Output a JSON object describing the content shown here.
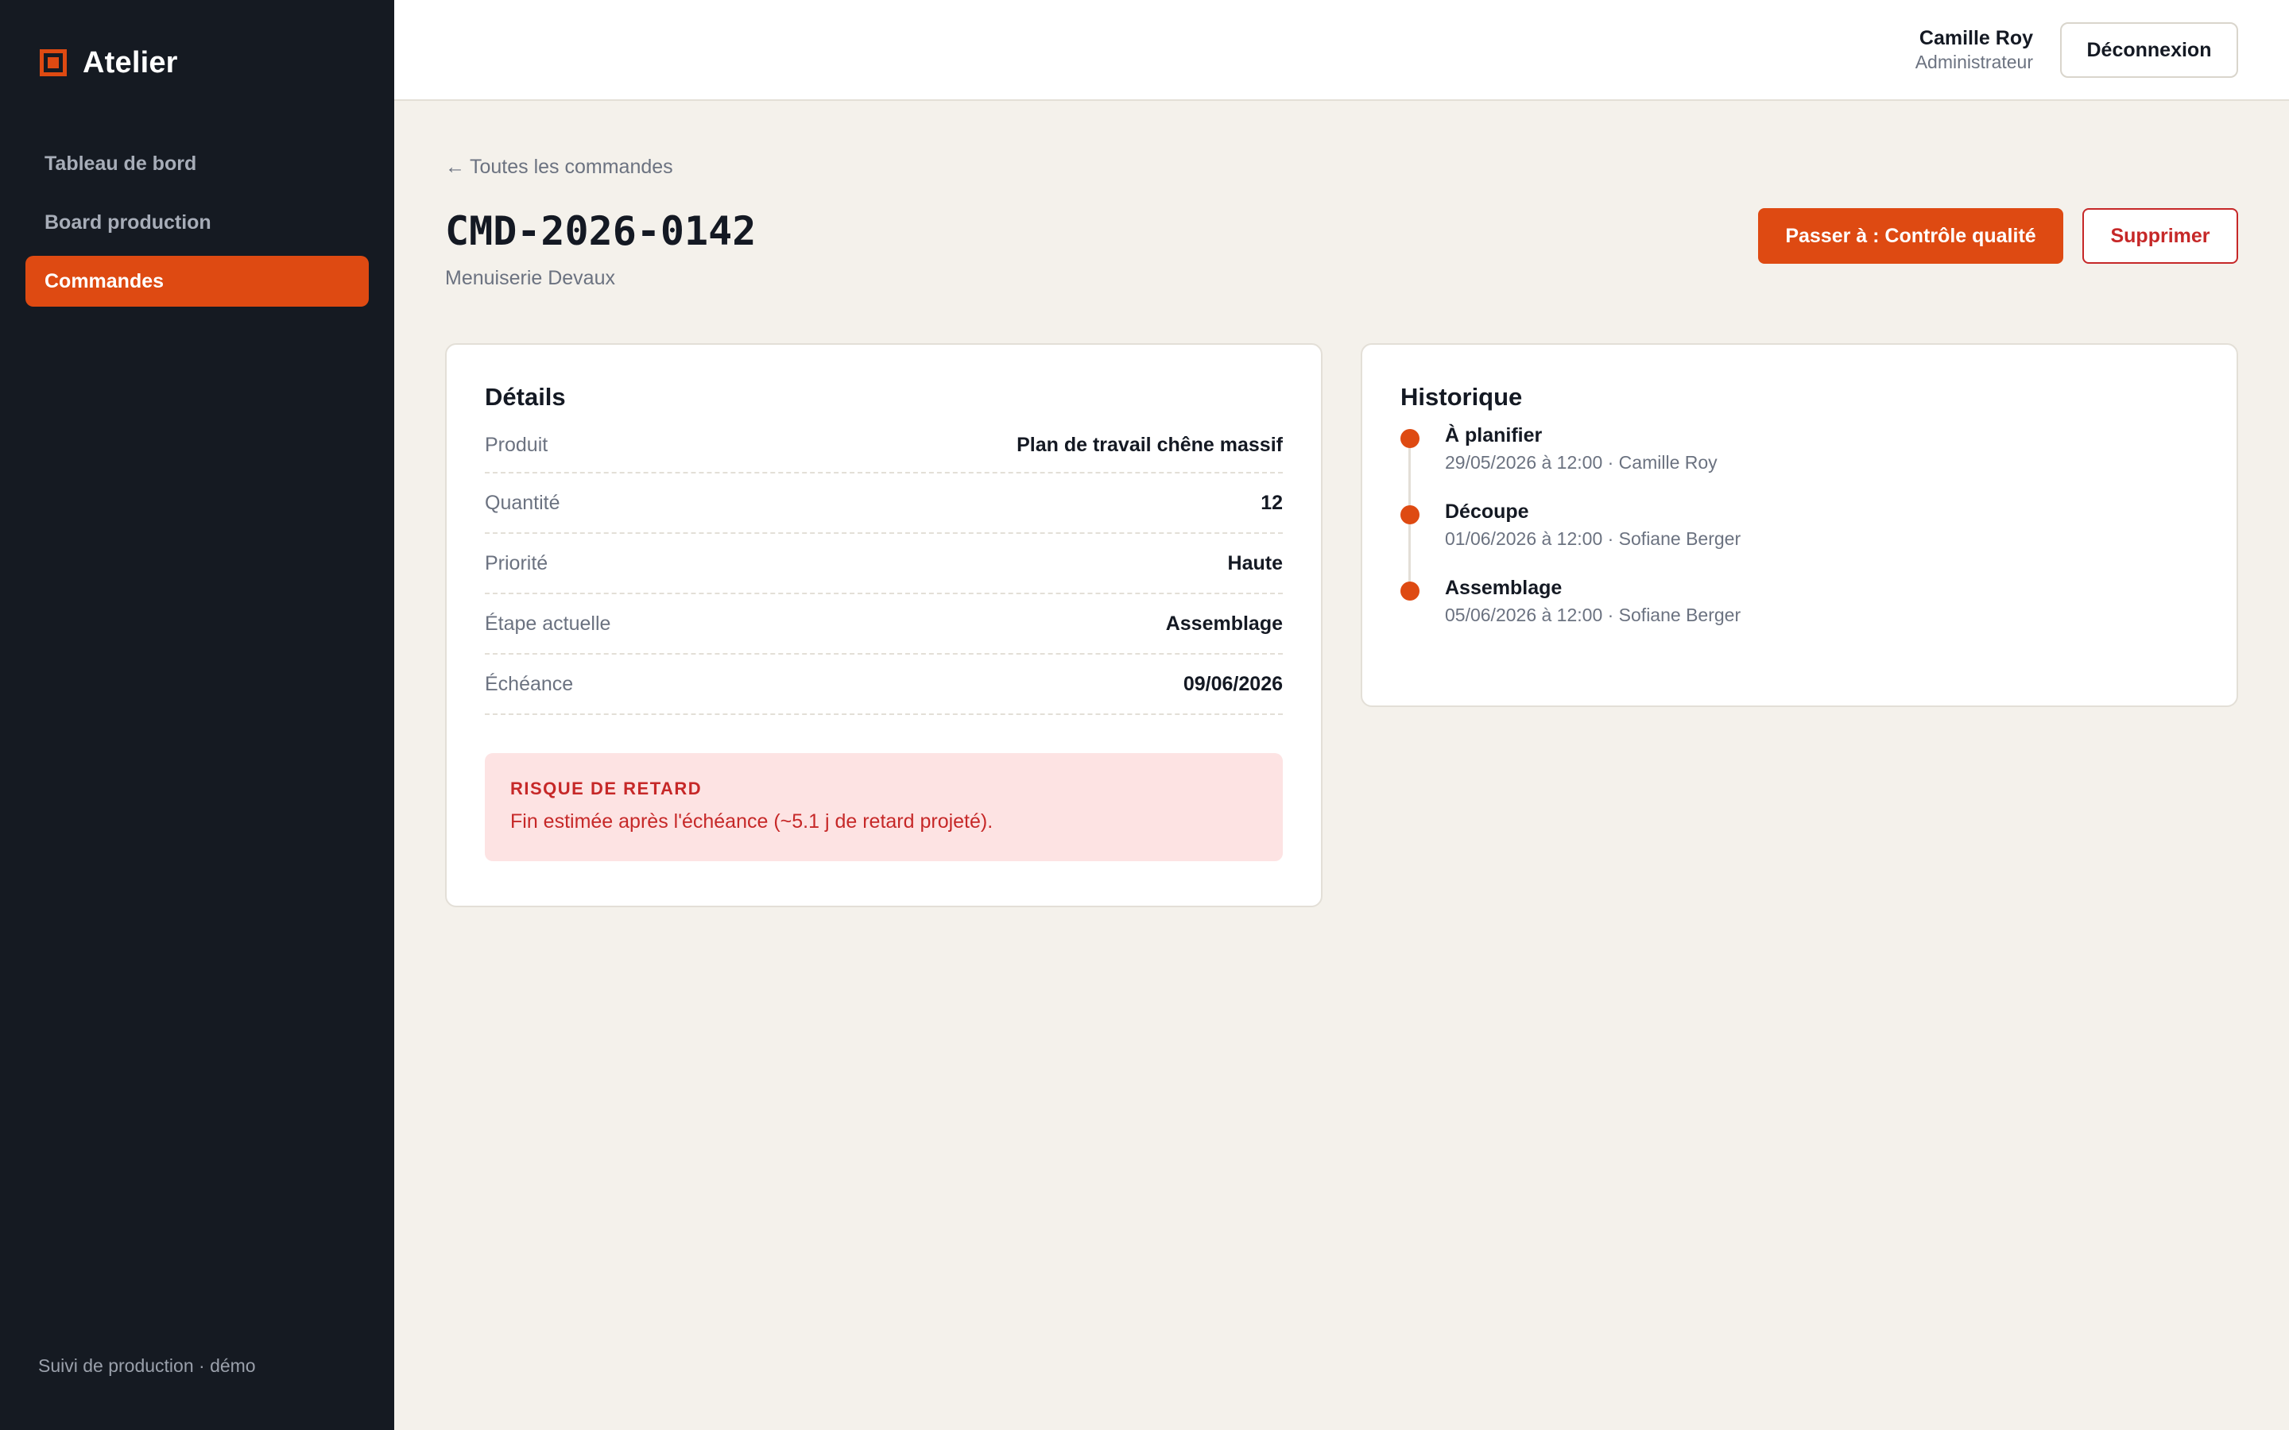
{
  "sidebar": {
    "brand": "Atelier",
    "items": [
      {
        "label": "Tableau de bord",
        "active": false
      },
      {
        "label": "Board production",
        "active": false
      },
      {
        "label": "Commandes",
        "active": true
      }
    ],
    "footer": "Suivi de production · démo"
  },
  "topbar": {
    "user_name": "Camille Roy",
    "user_role": "Administrateur",
    "logout_label": "Déconnexion"
  },
  "page": {
    "back_arrow": "←",
    "back_label": "Toutes les commandes",
    "title": "CMD-2026-0142",
    "subtitle": "Menuiserie Devaux",
    "primary_action": "Passer à : Contrôle qualité",
    "delete_action": "Supprimer"
  },
  "details": {
    "title": "Détails",
    "rows": [
      {
        "label": "Produit",
        "value": "Plan de travail chêne massif"
      },
      {
        "label": "Quantité",
        "value": "12"
      },
      {
        "label": "Priorité",
        "value": "Haute"
      },
      {
        "label": "Étape actuelle",
        "value": "Assemblage"
      },
      {
        "label": "Échéance",
        "value": "09/06/2026"
      }
    ],
    "alert": {
      "title": "RISQUE DE RETARD",
      "text": "Fin estimée après l'échéance (~5.1 j de retard projeté)."
    }
  },
  "history": {
    "title": "Historique",
    "items": [
      {
        "title": "À planifier",
        "meta": "29/05/2026 à 12:00 · Camille Roy"
      },
      {
        "title": "Découpe",
        "meta": "01/06/2026 à 12:00 · Sofiane Berger"
      },
      {
        "title": "Assemblage",
        "meta": "05/06/2026 à 12:00 · Sofiane Berger"
      }
    ]
  },
  "colors": {
    "accent": "#de4a12",
    "sidebar_bg": "#151a22",
    "danger": "#c62828",
    "alert_bg": "#fde3e3",
    "page_bg": "#f4f1eb"
  }
}
